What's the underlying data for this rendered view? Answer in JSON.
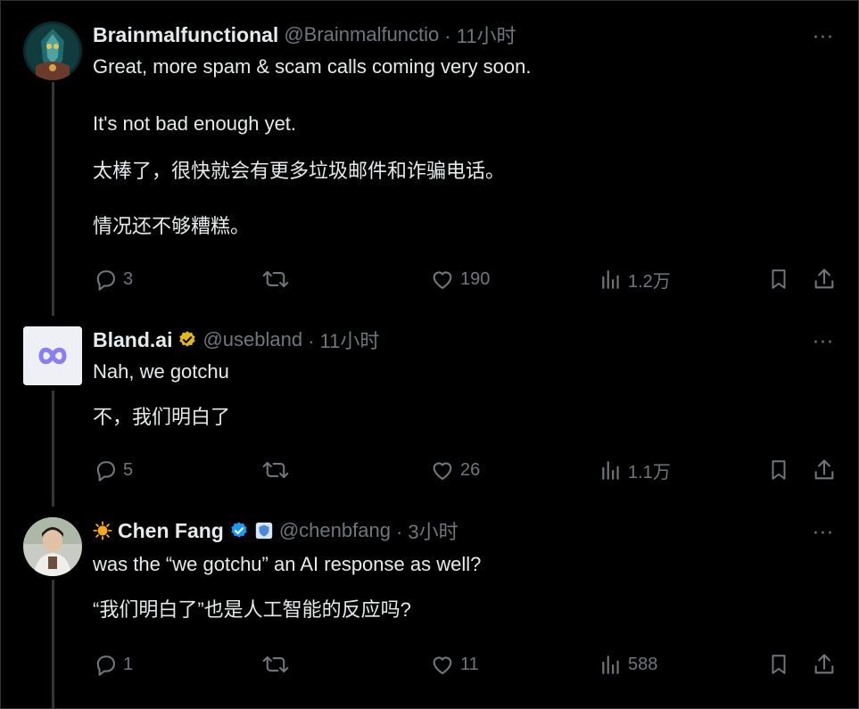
{
  "tweets": [
    {
      "name": "Brainmalfunctional",
      "handle": "@Brainmalfunctio",
      "time": "· 11小时",
      "more": "···",
      "lines": [
        "Great, more spam & scam calls coming very soon.",
        "It's not bad enough yet.",
        "太棒了，很快就会有更多垃圾邮件和诈骗电话。",
        "情况还不够糟糕。"
      ],
      "stats": {
        "replies": "3",
        "retweets": "",
        "likes": "190",
        "views": "1.2万"
      },
      "icons": [
        "reply-icon",
        "retweet-icon",
        "like-icon",
        "views-icon",
        "bookmark-icon",
        "share-icon"
      ]
    },
    {
      "name": "Bland.ai",
      "handle": "@usebland",
      "time": "· 11小时",
      "more": "···",
      "verified": "gold",
      "lines": [
        "Nah, we gotchu",
        "不，我们明白了"
      ],
      "stats": {
        "replies": "5",
        "retweets": "",
        "likes": "26",
        "views": "1.1万"
      }
    },
    {
      "name": "Chen Fang",
      "handle": "@chenbfang",
      "time": "· 3小时",
      "more": "···",
      "verified": "blue",
      "lines": [
        "was the “we gotchu” an AI response as well?",
        "“我们明白了”也是人工智能的反应吗?"
      ],
      "stats": {
        "replies": "1",
        "retweets": "",
        "likes": "11",
        "views": "588"
      }
    }
  ],
  "colors": {
    "background": "#000000",
    "text": "#e7e9ea",
    "muted": "#71767b",
    "gold": "#e2b719",
    "blue": "#1d9bf0",
    "line": "#333639"
  }
}
